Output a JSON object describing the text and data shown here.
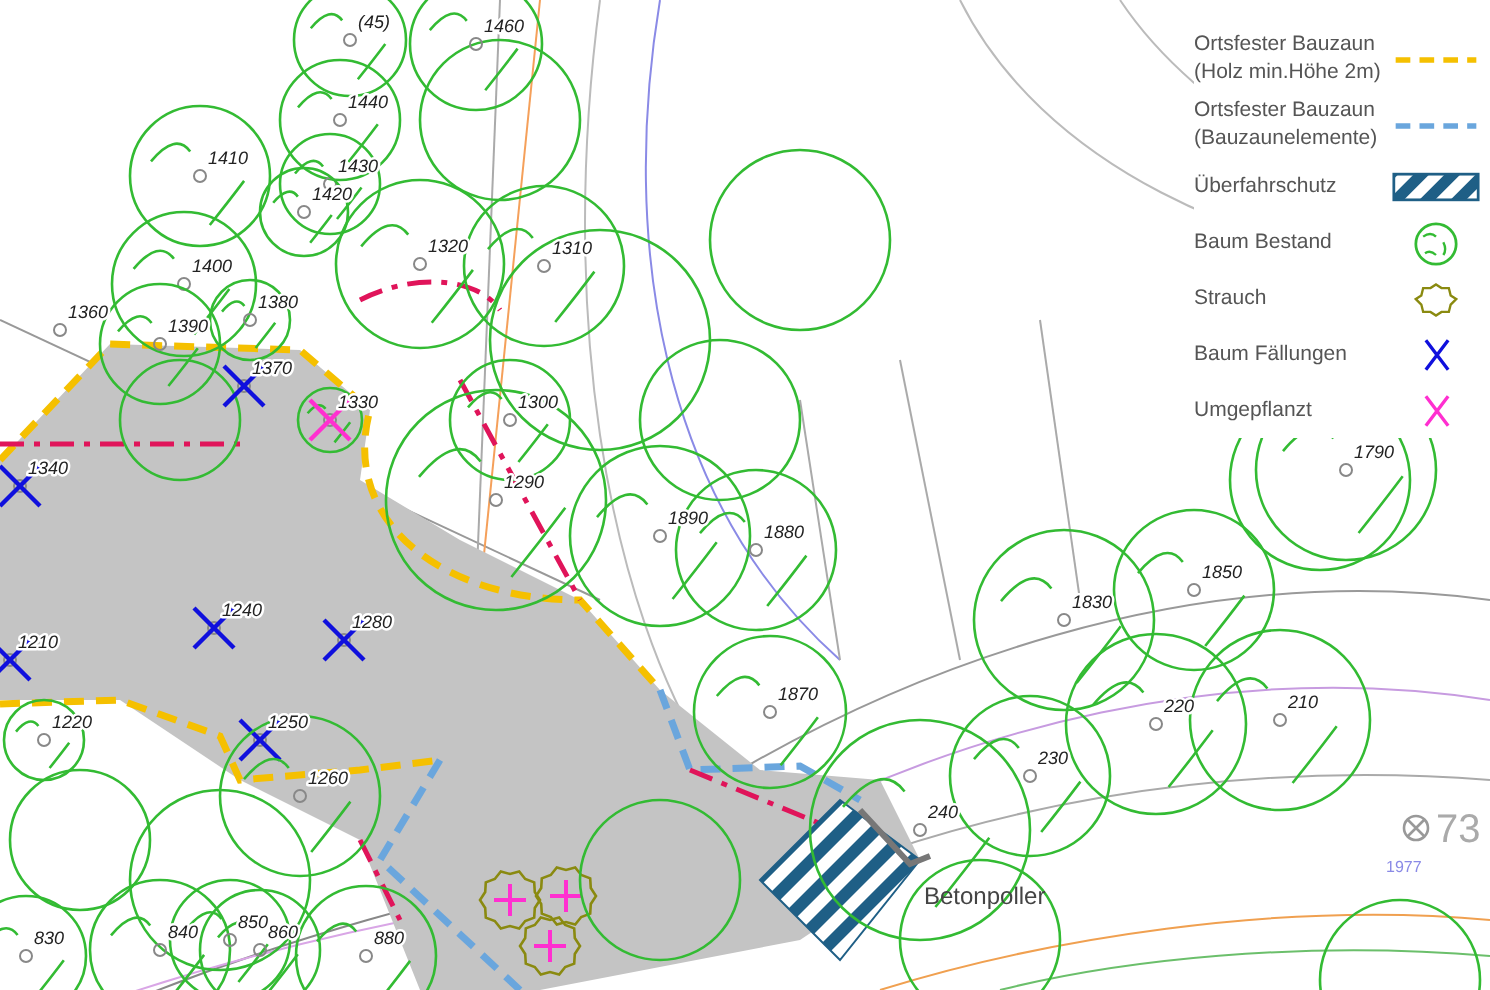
{
  "legend": [
    {
      "label": "Ortsfester Bauzaun (Holz min.Höhe 2m)",
      "kind": "fence-wood"
    },
    {
      "label": "Ortsfester Bauzaun (Bauzaunelemente)",
      "kind": "fence-panel"
    },
    {
      "label": "Überfahrschutz",
      "kind": "drive-over"
    },
    {
      "label": "Baum Bestand",
      "kind": "tree"
    },
    {
      "label": "Strauch",
      "kind": "shrub"
    },
    {
      "label": "Baum Fällungen",
      "kind": "felled"
    },
    {
      "label": "Umgepflanzt",
      "kind": "replanted"
    }
  ],
  "trees": [
    {
      "label": "(45)",
      "kind": "tree"
    },
    {
      "label": "1460",
      "kind": "tree"
    },
    {
      "label": "1440",
      "kind": "tree"
    },
    {
      "label": "1410",
      "kind": "tree"
    },
    {
      "label": "1430",
      "kind": "tree"
    },
    {
      "label": "1420",
      "kind": "tree"
    },
    {
      "label": "1400",
      "kind": "tree"
    },
    {
      "label": "1320",
      "kind": "tree"
    },
    {
      "label": "1310",
      "kind": "tree"
    },
    {
      "label": "1360",
      "kind": "tree"
    },
    {
      "label": "1380",
      "kind": "tree"
    },
    {
      "label": "1390",
      "kind": "tree"
    },
    {
      "label": "1370",
      "kind": "felled"
    },
    {
      "label": "1330",
      "kind": "replanted"
    },
    {
      "label": "1340",
      "kind": "felled"
    },
    {
      "label": "1300",
      "kind": "tree"
    },
    {
      "label": "1290",
      "kind": "tree"
    },
    {
      "label": "1890",
      "kind": "tree"
    },
    {
      "label": "1880",
      "kind": "tree"
    },
    {
      "label": "1870",
      "kind": "tree"
    },
    {
      "label": "1830",
      "kind": "tree"
    },
    {
      "label": "1850",
      "kind": "tree"
    },
    {
      "label": "1790",
      "kind": "tree"
    },
    {
      "label": "220",
      "kind": "tree"
    },
    {
      "label": "210",
      "kind": "tree"
    },
    {
      "label": "230",
      "kind": "tree"
    },
    {
      "label": "240",
      "kind": "tree"
    },
    {
      "label": "1240",
      "kind": "felled"
    },
    {
      "label": "1280",
      "kind": "felled"
    },
    {
      "label": "1210",
      "kind": "felled"
    },
    {
      "label": "1250",
      "kind": "felled"
    },
    {
      "label": "1220",
      "kind": "tree"
    },
    {
      "label": "1260",
      "kind": "tree"
    },
    {
      "label": "830",
      "kind": "tree"
    },
    {
      "label": "840",
      "kind": "tree"
    },
    {
      "label": "850",
      "kind": "tree"
    },
    {
      "label": "860",
      "kind": "tree"
    },
    {
      "label": "880",
      "kind": "tree"
    }
  ],
  "callout": "Betonpoller",
  "point_marker": "73",
  "year_note": "1977"
}
